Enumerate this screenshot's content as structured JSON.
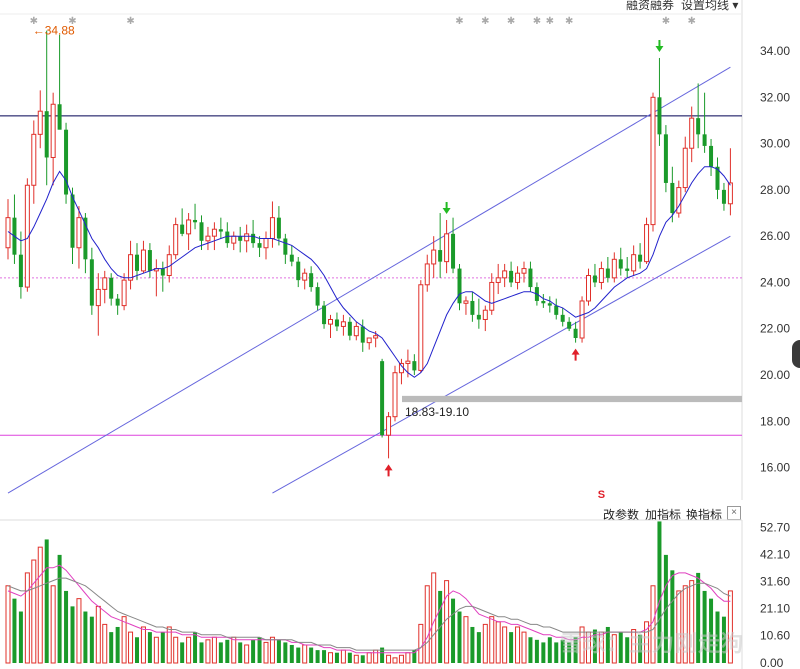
{
  "header": {
    "margin_label": "融资融券",
    "ma_setting_label": "设置均线",
    "ma_setting_caret": "▾"
  },
  "chart_data": [
    {
      "type": "candlestick",
      "title": "",
      "y_axis": {
        "ticks": [
          16,
          18,
          20,
          22,
          24,
          26,
          28,
          30,
          32,
          34
        ],
        "tick_labels": [
          "16.00",
          "18.00",
          "20.00",
          "22.00",
          "24.00",
          "26.00",
          "28.00",
          "30.00",
          "32.00",
          "34.00"
        ],
        "ylim": [
          14.6,
          35.6
        ]
      },
      "colors": {
        "up": "#e0302a",
        "down": "#1a9a2a",
        "ma": "#2222cc",
        "channel": "#6666dd",
        "resistance": "#000055",
        "support": "#dd44dd",
        "dotted_level": "#e070e0"
      },
      "ohlc": [
        [
          25.5,
          27.6,
          25.0,
          26.8
        ],
        [
          26.8,
          27.8,
          24.8,
          25.2
        ],
        [
          25.2,
          26.2,
          23.3,
          23.8
        ],
        [
          23.8,
          28.5,
          23.6,
          28.2
        ],
        [
          28.2,
          31.0,
          27.4,
          30.4
        ],
        [
          30.4,
          32.3,
          29.8,
          31.4
        ],
        [
          31.4,
          34.88,
          28.2,
          29.4
        ],
        [
          29.4,
          32.2,
          28.2,
          31.7
        ],
        [
          31.7,
          34.7,
          31.1,
          30.6
        ],
        [
          30.6,
          30.9,
          27.4,
          27.8
        ],
        [
          27.8,
          28.1,
          24.8,
          25.5
        ],
        [
          25.5,
          27.3,
          24.6,
          26.8
        ],
        [
          26.8,
          27.0,
          24.4,
          25.0
        ],
        [
          25.0,
          25.5,
          22.6,
          23.0
        ],
        [
          23.0,
          24.4,
          21.7,
          23.7
        ],
        [
          23.7,
          24.5,
          23.1,
          24.2
        ],
        [
          24.2,
          24.4,
          23.0,
          23.3
        ],
        [
          23.3,
          23.5,
          22.6,
          23.0
        ],
        [
          23.0,
          24.4,
          22.8,
          24.1
        ],
        [
          24.1,
          25.8,
          23.7,
          25.2
        ],
        [
          25.2,
          25.7,
          24.1,
          24.5
        ],
        [
          24.5,
          25.8,
          24.4,
          25.4
        ],
        [
          25.4,
          25.7,
          24.2,
          24.5
        ],
        [
          24.5,
          25.0,
          23.4,
          24.6
        ],
        [
          24.6,
          24.9,
          23.6,
          24.3
        ],
        [
          24.3,
          25.6,
          24.0,
          25.2
        ],
        [
          25.2,
          26.8,
          25.0,
          26.5
        ],
        [
          26.5,
          27.2,
          26.0,
          26.1
        ],
        [
          26.1,
          27.0,
          25.4,
          26.7
        ],
        [
          26.7,
          27.4,
          26.3,
          26.6
        ],
        [
          26.6,
          26.9,
          25.4,
          25.8
        ],
        [
          25.8,
          26.4,
          25.4,
          26.0
        ],
        [
          26.0,
          26.6,
          25.4,
          26.3
        ],
        [
          26.3,
          26.8,
          25.9,
          26.2
        ],
        [
          26.2,
          26.6,
          25.5,
          25.7
        ],
        [
          25.7,
          26.2,
          25.4,
          26.0
        ],
        [
          26.0,
          26.4,
          25.3,
          25.8
        ],
        [
          25.8,
          26.5,
          25.3,
          26.1
        ],
        [
          26.1,
          26.7,
          25.5,
          25.7
        ],
        [
          25.7,
          26.0,
          25.1,
          25.5
        ],
        [
          25.5,
          26.2,
          25.0,
          25.9
        ],
        [
          25.9,
          27.5,
          25.5,
          26.8
        ],
        [
          26.8,
          27.3,
          25.6,
          25.9
        ],
        [
          25.9,
          26.1,
          24.8,
          25.2
        ],
        [
          25.2,
          25.6,
          24.7,
          24.9
        ],
        [
          24.9,
          25.1,
          23.8,
          24.1
        ],
        [
          24.1,
          24.6,
          23.7,
          24.4
        ],
        [
          24.4,
          24.7,
          23.6,
          23.8
        ],
        [
          23.8,
          24.0,
          22.8,
          23.0
        ],
        [
          23.0,
          23.2,
          22.0,
          22.2
        ],
        [
          22.2,
          22.6,
          21.6,
          22.4
        ],
        [
          22.4,
          22.7,
          21.9,
          22.1
        ],
        [
          22.1,
          22.6,
          21.7,
          22.3
        ],
        [
          22.3,
          22.5,
          21.5,
          21.7
        ],
        [
          21.7,
          22.3,
          21.5,
          22.1
        ],
        [
          22.1,
          22.4,
          21.0,
          21.4
        ],
        [
          21.4,
          21.6,
          21.1,
          21.6
        ],
        [
          21.6,
          21.9,
          21.2,
          21.7
        ],
        [
          20.6,
          20.7,
          17.3,
          17.4
        ],
        [
          17.4,
          18.4,
          16.4,
          18.2
        ],
        [
          18.2,
          20.4,
          18.0,
          20.1
        ],
        [
          20.1,
          20.7,
          19.6,
          20.5
        ],
        [
          20.5,
          21.1,
          19.9,
          20.6
        ],
        [
          20.6,
          20.9,
          20.0,
          20.2
        ],
        [
          20.2,
          24.1,
          20.1,
          23.9
        ],
        [
          23.9,
          25.2,
          23.6,
          24.8
        ],
        [
          24.8,
          26.0,
          24.2,
          25.4
        ],
        [
          25.4,
          27.0,
          24.2,
          24.9
        ],
        [
          24.9,
          26.7,
          24.4,
          26.1
        ],
        [
          26.1,
          26.8,
          24.4,
          24.6
        ],
        [
          24.6,
          24.8,
          22.8,
          23.1
        ],
        [
          23.1,
          23.4,
          22.6,
          23.2
        ],
        [
          23.2,
          23.6,
          22.3,
          22.6
        ],
        [
          22.6,
          23.3,
          22.0,
          22.4
        ],
        [
          22.4,
          23.0,
          21.9,
          22.8
        ],
        [
          22.8,
          24.4,
          22.6,
          24.0
        ],
        [
          24.0,
          24.8,
          23.5,
          24.2
        ],
        [
          24.2,
          24.8,
          23.8,
          24.5
        ],
        [
          24.5,
          24.9,
          23.8,
          24.0
        ],
        [
          24.0,
          24.7,
          23.7,
          24.4
        ],
        [
          24.4,
          24.9,
          24.0,
          24.6
        ],
        [
          24.6,
          24.9,
          23.6,
          23.8
        ],
        [
          23.8,
          24.0,
          23.0,
          23.2
        ],
        [
          23.2,
          23.5,
          22.9,
          23.1
        ],
        [
          23.1,
          23.4,
          22.7,
          23.0
        ],
        [
          23.0,
          23.3,
          22.4,
          22.6
        ],
        [
          22.6,
          22.9,
          22.1,
          22.3
        ],
        [
          22.3,
          22.5,
          21.9,
          22.0
        ],
        [
          22.0,
          22.3,
          21.4,
          21.6
        ],
        [
          21.6,
          23.4,
          21.4,
          23.2
        ],
        [
          23.2,
          24.6,
          23.0,
          24.3
        ],
        [
          24.3,
          24.8,
          23.8,
          24.0
        ],
        [
          24.0,
          24.9,
          23.7,
          24.6
        ],
        [
          24.6,
          25.1,
          24.0,
          24.2
        ],
        [
          24.2,
          25.3,
          24.0,
          25.0
        ],
        [
          25.0,
          25.5,
          24.3,
          24.6
        ],
        [
          24.6,
          25.1,
          24.2,
          24.5
        ],
        [
          24.5,
          25.6,
          24.3,
          25.2
        ],
        [
          25.2,
          25.7,
          24.6,
          24.9
        ],
        [
          24.9,
          26.8,
          24.8,
          26.5
        ],
        [
          26.5,
          32.2,
          26.2,
          32.0
        ],
        [
          32.0,
          33.7,
          29.9,
          30.4
        ],
        [
          30.4,
          30.8,
          27.9,
          28.3
        ],
        [
          28.3,
          29.0,
          26.6,
          27.0
        ],
        [
          27.0,
          28.4,
          26.8,
          28.1
        ],
        [
          28.1,
          30.3,
          27.9,
          29.8
        ],
        [
          29.8,
          31.6,
          29.2,
          31.1
        ],
        [
          31.1,
          32.6,
          29.8,
          30.4
        ],
        [
          30.4,
          32.2,
          29.6,
          29.9
        ],
        [
          29.9,
          30.2,
          28.6,
          29.0
        ],
        [
          29.0,
          29.4,
          27.6,
          28.0
        ],
        [
          28.0,
          28.3,
          27.1,
          27.4
        ],
        [
          27.4,
          29.8,
          26.9,
          28.3
        ]
      ],
      "ma_line": [
        26.2,
        26.0,
        25.8,
        25.9,
        26.4,
        27.0,
        27.6,
        28.3,
        28.8,
        28.4,
        27.7,
        27.1,
        26.5,
        25.9,
        25.5,
        25.0,
        24.6,
        24.3,
        24.2,
        24.2,
        24.3,
        24.4,
        24.5,
        24.6,
        24.6,
        24.7,
        24.9,
        25.1,
        25.3,
        25.5,
        25.6,
        25.7,
        25.8,
        25.9,
        26.0,
        26.0,
        26.0,
        26.0,
        26.0,
        25.9,
        25.9,
        25.9,
        25.8,
        25.7,
        25.6,
        25.4,
        25.2,
        25.0,
        24.7,
        24.3,
        23.8,
        23.3,
        22.9,
        22.6,
        22.3,
        22.1,
        21.9,
        21.8,
        21.6,
        21.2,
        20.8,
        20.4,
        20.1,
        19.9,
        20.1,
        20.5,
        21.2,
        21.9,
        22.6,
        23.1,
        23.5,
        23.6,
        23.6,
        23.4,
        23.2,
        23.1,
        23.2,
        23.3,
        23.4,
        23.5,
        23.6,
        23.6,
        23.5,
        23.3,
        23.2,
        23.0,
        22.9,
        22.7,
        22.5,
        22.6,
        22.7,
        22.9,
        23.2,
        23.5,
        23.8,
        24.0,
        24.2,
        24.3,
        24.4,
        24.6,
        25.2,
        26.0,
        26.6,
        26.9,
        27.3,
        27.8,
        28.3,
        28.7,
        29.0,
        29.0,
        28.9,
        28.6,
        28.2
      ],
      "levels": {
        "resistance": 31.2,
        "support": 17.4,
        "dotted_level": 24.2
      },
      "channel_upper": [
        [
          0,
          14.9
        ],
        [
          112,
          33.3
        ]
      ],
      "channel_lower": [
        [
          41,
          14.9
        ],
        [
          112,
          26.0
        ]
      ],
      "zone_label": "18.83-19.10",
      "zone_range": [
        18.83,
        19.1
      ],
      "max_label": "34.88",
      "signals": [
        {
          "type": "buy",
          "index": 59
        },
        {
          "type": "buy",
          "index": 88
        },
        {
          "type": "sell",
          "index": 68
        },
        {
          "type": "sell",
          "index": 101
        }
      ],
      "event_markers": [
        4,
        10,
        19,
        70,
        74,
        78,
        82,
        84,
        87,
        102,
        106
      ]
    },
    {
      "type": "bar",
      "title": "",
      "y_axis": {
        "ticks": [
          0,
          10.6,
          21.1,
          31.6,
          42.1,
          52.7
        ],
        "tick_labels": [
          "0.00",
          "10.60",
          "21.10",
          "31.60",
          "42.10",
          "52.70"
        ],
        "ylim": [
          0,
          54
        ]
      },
      "volume": [
        30,
        25,
        20,
        35,
        40,
        45,
        48,
        30,
        42,
        28,
        22,
        25,
        20,
        18,
        22,
        15,
        12,
        14,
        18,
        12,
        10,
        14,
        12,
        10,
        12,
        14,
        10,
        8,
        10,
        12,
        8,
        9,
        10,
        8,
        9,
        10,
        8,
        7,
        9,
        10,
        8,
        10,
        9,
        8,
        7,
        6,
        7,
        6,
        5,
        5,
        4,
        4,
        5,
        4,
        3,
        3,
        4,
        5,
        6,
        3,
        2,
        3,
        4,
        5,
        15,
        30,
        35,
        28,
        32,
        25,
        20,
        18,
        14,
        12,
        15,
        18,
        16,
        14,
        12,
        14,
        12,
        10,
        9,
        8,
        10,
        8,
        9,
        8,
        10,
        14,
        12,
        13,
        12,
        14,
        11,
        12,
        10,
        13,
        11,
        16,
        30,
        55,
        42,
        36,
        28,
        30,
        32,
        35,
        28,
        25,
        20,
        18,
        28
      ],
      "ma_vol_pink": [
        28,
        27,
        26,
        28,
        31,
        34,
        37,
        37,
        38,
        36,
        33,
        30,
        27,
        24,
        22,
        20,
        18,
        17,
        16,
        15,
        14,
        13,
        13,
        12,
        12,
        12,
        12,
        11,
        11,
        11,
        10,
        10,
        10,
        10,
        10,
        9,
        9,
        9,
        9,
        9,
        9,
        9,
        9,
        9,
        8,
        8,
        7,
        7,
        7,
        6,
        6,
        5,
        5,
        5,
        4,
        4,
        4,
        4,
        4,
        4,
        4,
        4,
        4,
        4,
        6,
        10,
        16,
        21,
        26,
        28,
        27,
        25,
        22,
        19,
        18,
        17,
        16,
        16,
        15,
        15,
        14,
        13,
        12,
        11,
        11,
        10,
        10,
        9,
        9,
        10,
        10,
        11,
        11,
        12,
        12,
        12,
        12,
        12,
        12,
        13,
        16,
        24,
        30,
        34,
        35,
        35,
        34,
        33,
        31,
        29,
        26,
        24,
        24
      ],
      "ma_vol_gray": [
        30,
        29,
        28,
        28,
        29,
        30,
        31,
        32,
        33,
        33,
        32,
        31,
        30,
        28,
        26,
        24,
        22,
        20,
        19,
        18,
        17,
        16,
        15,
        14,
        14,
        13,
        13,
        12,
        12,
        12,
        11,
        11,
        11,
        11,
        10,
        10,
        10,
        10,
        10,
        10,
        9,
        9,
        9,
        9,
        9,
        8,
        8,
        8,
        7,
        7,
        7,
        6,
        6,
        6,
        5,
        5,
        5,
        5,
        5,
        5,
        5,
        5,
        5,
        5,
        6,
        8,
        11,
        14,
        17,
        19,
        21,
        22,
        22,
        21,
        20,
        19,
        18,
        18,
        17,
        17,
        16,
        15,
        15,
        14,
        14,
        13,
        12,
        12,
        12,
        12,
        12,
        12,
        12,
        12,
        12,
        12,
        12,
        12,
        12,
        12,
        13,
        17,
        21,
        24,
        27,
        29,
        30,
        31,
        31,
        30,
        29,
        27,
        26
      ]
    }
  ],
  "indicator_toolbar": {
    "change_params": "改参数",
    "add_indicator": "加指标",
    "switch_indicator": "换指标",
    "close": "×"
  },
  "watermark": "雪球：主力刚走狗"
}
